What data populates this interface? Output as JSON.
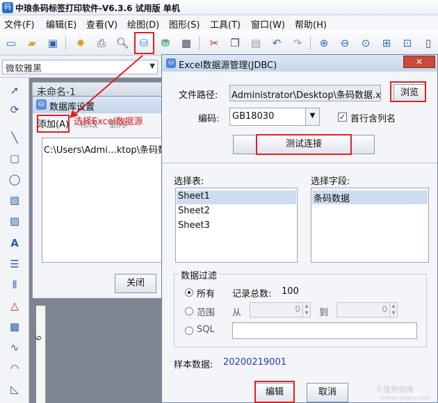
{
  "app": {
    "title": "中琅条码标签打印软件-V6.3.6 试用版 单机",
    "menu": [
      "文件(F)",
      "编辑(E)",
      "查看(V)",
      "绘图(D)",
      "图形(S)",
      "工具(T)",
      "窗口(W)",
      "帮助(H)"
    ],
    "font_name": "微软雅黑",
    "document_tab": "未命名-1",
    "ruler_label": "6"
  },
  "db_dialog": {
    "title": "数据库设置",
    "menu": {
      "add": "添加(A)",
      "modify": "修改",
      "delete": "删除"
    },
    "rows": [
      "C:\\Users\\Admi…ktop\\条码数"
    ],
    "close_label": "关闭"
  },
  "annotation": {
    "text": "选择Excel数据源",
    "color": "#e02020"
  },
  "excel_dialog": {
    "title": "Excel数据源管理(JDBC)",
    "close_symbol": "✕",
    "file_path_label": "文件路径:",
    "file_path_value": "Administrator\\Desktop\\条码数据.xls",
    "browse_label": "浏览",
    "encoding_label": "编码:",
    "encoding_value": "GB18030",
    "header_checkbox_label": "首行含列名",
    "header_checkbox_checked": true,
    "test_connection_label": "测试连接",
    "select_table_label": "选择表:",
    "tables": [
      "Sheet1",
      "Sheet2",
      "Sheet3"
    ],
    "selected_table": "Sheet1",
    "select_field_label": "选择字段:",
    "fields": [
      "条码数据"
    ],
    "filter": {
      "title": "数据过滤",
      "all_label": "所有",
      "record_total_label": "记录总数:",
      "record_total_value": "100",
      "range_label": "范围",
      "from_label": "从",
      "from_value": "0",
      "to_label": "到",
      "to_value": "0",
      "sql_label": "SQL",
      "sql_value": "",
      "selected": "all"
    },
    "sample_label": "样本数据:",
    "sample_value": "20200219001",
    "edit_label": "编辑",
    "cancel_label": "取消"
  },
  "watermark": {
    "text": "Ⓢ搜狗指南",
    "sub": "zhinan.sogou.com"
  }
}
